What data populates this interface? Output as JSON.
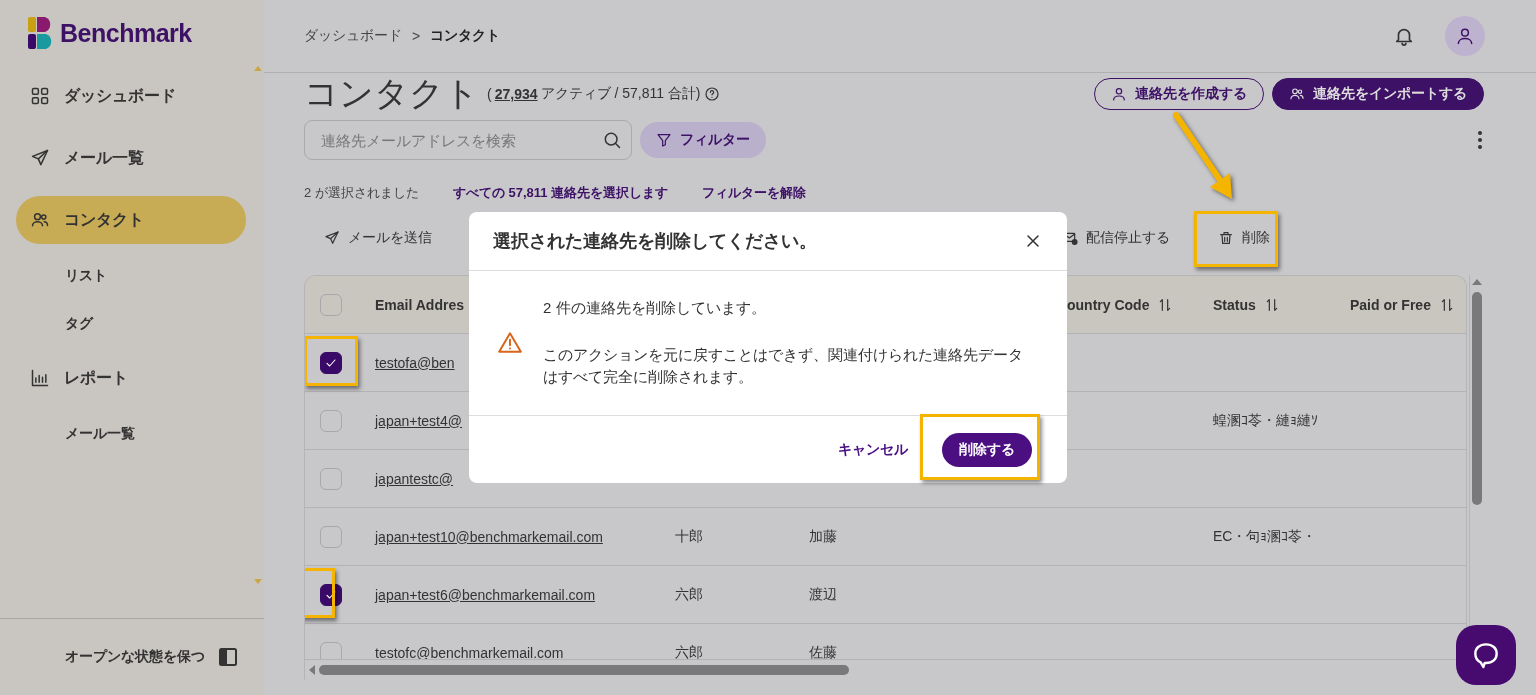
{
  "sidebar": {
    "logo": "Benchmark",
    "items": [
      {
        "label": "ダッシュボード",
        "selected": false
      },
      {
        "label": "メール一覧",
        "selected": false
      },
      {
        "label": "コンタクト",
        "selected": true,
        "children": [
          {
            "label": "リスト",
            "selected": false
          },
          {
            "label": "タグ",
            "selected": false
          }
        ]
      },
      {
        "label": "レポート",
        "selected": false,
        "children": [
          {
            "label": "メール一覧",
            "selected": false
          }
        ]
      }
    ],
    "footer": "オープンな状態を保つ"
  },
  "breadcrumb": [
    {
      "label": "ダッシュボード"
    },
    {
      "label": ">"
    },
    {
      "label": "コンタクト"
    }
  ],
  "page": {
    "title": "コンタクト",
    "count_open": "(",
    "count_active": "27,934",
    "count_rest": "アクティブ / 57,811 合計)",
    "buttons": [
      {
        "label": "連絡先を作成する",
        "kind": "outline"
      },
      {
        "label": "連絡先をインポートする",
        "kind": "filled"
      }
    ]
  },
  "search": {
    "placeholder": "連絡先メールアドレスを検索"
  },
  "filter_button": "フィルター",
  "selection": {
    "count": "2 が選択されました",
    "select_all": "すべての 57,811 連絡先を選択します",
    "clear_filter": "フィルターを解除"
  },
  "toolbar": [
    {
      "label": "メールを送信",
      "kind": "send",
      "highlighted": false,
      "pointer": false
    },
    {
      "label": "配信停止する",
      "kind": "unsubscribe",
      "highlighted": false,
      "pointer": false
    },
    {
      "label": "削除",
      "kind": "delete",
      "highlighted": true,
      "pointer": true
    }
  ],
  "table": {
    "all_selected": false,
    "columns": {
      "email": "Email Addres",
      "country_code": "ountry Code",
      "status": "Status",
      "paid_or_free": "Paid or Free"
    },
    "rows": [
      {
        "selected": true,
        "highlighted": true,
        "email": "testofa@ben"
      },
      {
        "selected": false,
        "highlighted": false,
        "email": "japan+test4@",
        "status": "蝗溷ｺ苓・縺ｮ縺ｿ"
      },
      {
        "selected": false,
        "highlighted": false,
        "email": "japantestc@"
      },
      {
        "selected": false,
        "highlighted": false,
        "email": "japan+test10@benchmarkemail.com",
        "first_name": "十郎",
        "last_name": "加藤",
        "status": "EC・句ｮ溷ｺ苓・"
      },
      {
        "selected": true,
        "highlighted": true,
        "email": "japan+test6@benchmarkemail.com",
        "first_name": "六郎",
        "last_name": "渡辺"
      },
      {
        "selected": false,
        "highlighted": false,
        "email": "testofc@benchmarkemail.com",
        "first_name": "六郎",
        "last_name": "佐藤"
      }
    ]
  },
  "dialog": {
    "title": "選択された連絡先を削除してください。",
    "message": "2 件の連絡先を削除しています。",
    "warning": "このアクションを元に戻すことはできず、関連付けられた連絡先データはすべて完全に削除されます。",
    "cancel": "キャンセル",
    "confirm": "削除する",
    "confirm_highlighted": true
  }
}
